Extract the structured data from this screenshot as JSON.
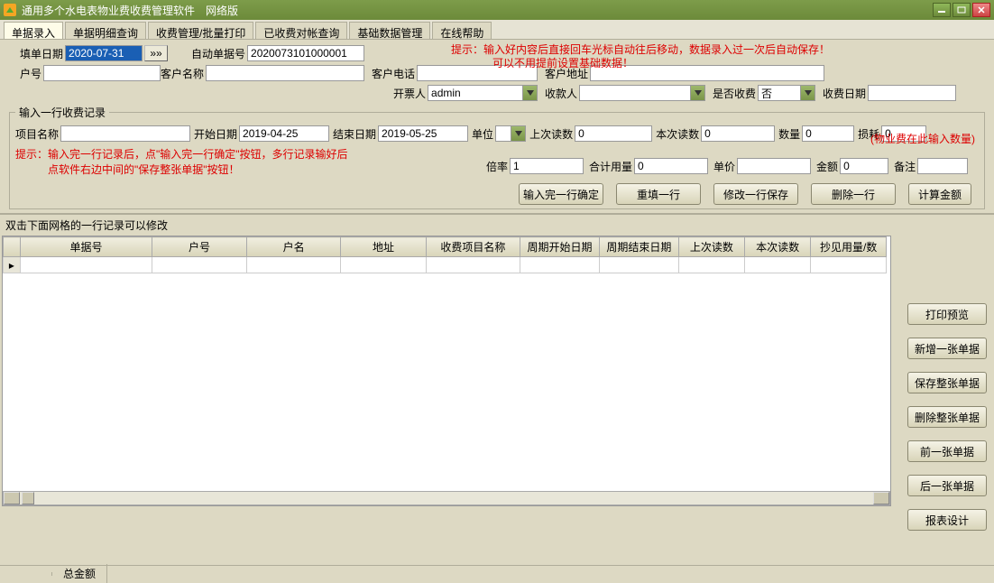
{
  "window": {
    "title": "通用多个水电表物业费收费管理软件　网络版"
  },
  "tabs": [
    "单据录入",
    "单据明细查询",
    "收费管理/批量打印",
    "已收费对帐查询",
    "基础数据管理",
    "在线帮助"
  ],
  "active_tab": 0,
  "form": {
    "fill_date_label": "填单日期",
    "fill_date": "2020-07-31",
    "auto_no_label": "自动单据号",
    "auto_no": "2020073101000001",
    "cust_no_label": "户号",
    "cust_no": "",
    "cust_name_label": "客户名称",
    "cust_name": "",
    "cust_phone_label": "客户电话",
    "cust_phone": "",
    "cust_addr_label": "客户地址",
    "cust_addr": "",
    "issuer_label": "开票人",
    "issuer": "admin",
    "payee_label": "收款人",
    "payee": "",
    "is_charge_label": "是否收费",
    "is_charge": "否",
    "charge_date_label": "收费日期",
    "charge_date": ""
  },
  "tip1": "提示：输入好内容后直接回车光标自动往后移动，数据录入过一次后自动保存！",
  "tip1b": "可以不用提前设置基础数据！",
  "record_legend": "输入一行收费记录",
  "record": {
    "item_label": "项目名称",
    "item": "",
    "start_label": "开始日期",
    "start": "2019-04-25",
    "end_label": "结束日期",
    "end": "2019-05-25",
    "unit_label": "单位",
    "unit": "",
    "last_read_label": "上次读数",
    "last_read": "0",
    "this_read_label": "本次读数",
    "this_read": "0",
    "qty_label": "数量",
    "qty": "0",
    "loss_label": "损耗",
    "loss": "0",
    "pf_tip": "(物业费在此输入数量)",
    "tip2a": "提示：输入完一行记录后，点\"输入完一行确定\"按钮，多行记录输好后",
    "tip2b": "点软件右边中间的\"保存整张单据\"按钮！",
    "multi_label": "倍率",
    "multi": "1",
    "total_use_label": "合计用量",
    "total_use": "0",
    "price_label": "单价",
    "price": "",
    "amount_label": "金额",
    "amount": "0",
    "remark_label": "备注",
    "remark": ""
  },
  "rec_btns": {
    "confirm": "输入完一行确定",
    "refill": "重填一行",
    "save_mod": "修改一行保存",
    "delete": "删除一行",
    "calc": "计算金额"
  },
  "grid_header": "双击下面网格的一行记录可以修改",
  "grid_cols": [
    "单据号",
    "户号",
    "户名",
    "地址",
    "收费项目名称",
    "周期开始日期",
    "周期结束日期",
    "上次读数",
    "本次读数",
    "抄见用量/数"
  ],
  "side_buttons": [
    "打印预览",
    "新增一张单据",
    "保存整张单据",
    "删除整张单据",
    "前一张单据",
    "后一张单据",
    "报表设计"
  ],
  "footer": {
    "total_label": "总金额"
  }
}
